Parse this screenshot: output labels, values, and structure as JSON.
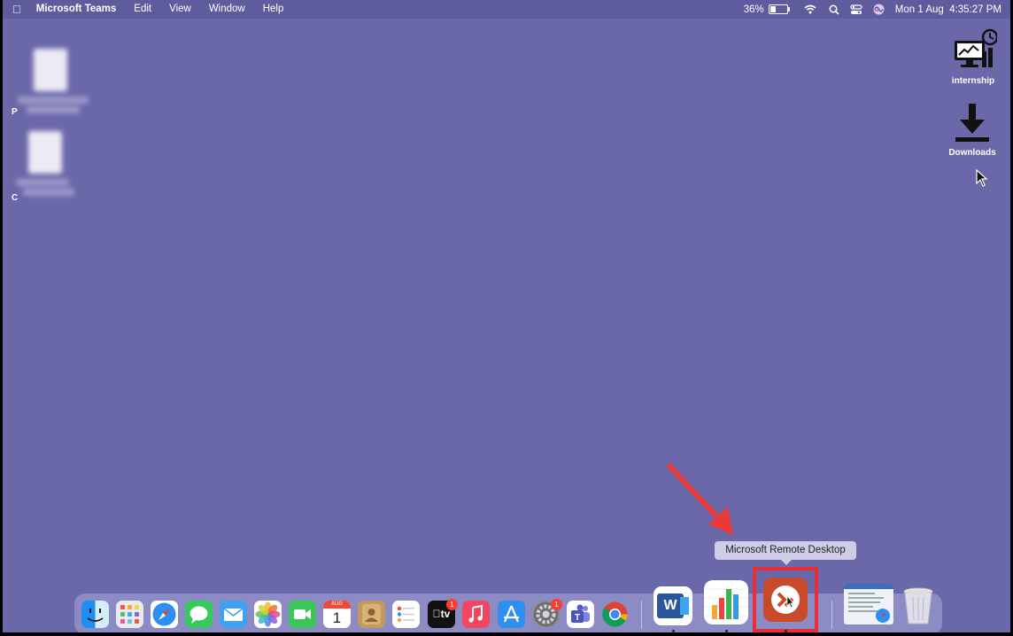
{
  "menubar": {
    "app_name": "Microsoft Teams",
    "menus": [
      "Edit",
      "View",
      "Window",
      "Help"
    ],
    "battery_percent": "36%",
    "battery_level": 0.36,
    "datetime": "Mon 1 Aug  4:35:27 PM"
  },
  "desktop": {
    "icons": [
      {
        "label": "internship",
        "icon": "monitor-chart-icon"
      },
      {
        "label": "Downloads",
        "icon": "download-icon"
      }
    ],
    "edge_chars": [
      "P",
      "C"
    ]
  },
  "tooltip": "Microsoft Remote Desktop",
  "dock": {
    "apps": [
      {
        "name": "finder",
        "icon": "finder-icon"
      },
      {
        "name": "launchpad",
        "icon": "launchpad-icon"
      },
      {
        "name": "safari",
        "icon": "safari-icon"
      },
      {
        "name": "messages",
        "icon": "messages-icon"
      },
      {
        "name": "mail",
        "icon": "mail-icon"
      },
      {
        "name": "photos",
        "icon": "photos-icon"
      },
      {
        "name": "facetime",
        "icon": "facetime-icon"
      },
      {
        "name": "calendar",
        "icon": "calendar-icon",
        "month": "AUG",
        "day": "1"
      },
      {
        "name": "contacts",
        "icon": "contacts-icon"
      },
      {
        "name": "reminders",
        "icon": "reminders-icon"
      },
      {
        "name": "apple-tv",
        "icon": "apple-tv-icon",
        "text": "tv",
        "badge": "1"
      },
      {
        "name": "music",
        "icon": "music-icon"
      },
      {
        "name": "app-store",
        "icon": "app-store-icon"
      },
      {
        "name": "system-preferences",
        "icon": "gear-icon",
        "badge": "1"
      },
      {
        "name": "teams",
        "icon": "teams-icon"
      },
      {
        "name": "chrome",
        "icon": "chrome-icon"
      },
      {
        "name": "word",
        "icon": "word-icon",
        "text": "W"
      },
      {
        "name": "numbers",
        "icon": "numbers-icon"
      },
      {
        "name": "remote-desktop",
        "icon": "remote-desktop-icon"
      },
      {
        "name": "document-preview",
        "icon": "document-icon"
      },
      {
        "name": "trash",
        "icon": "trash-icon"
      }
    ]
  },
  "colors": {
    "wallpaper": "#6b68aa",
    "highlight": "#ea2d38",
    "annotation_arrow": "#ea3a38"
  }
}
